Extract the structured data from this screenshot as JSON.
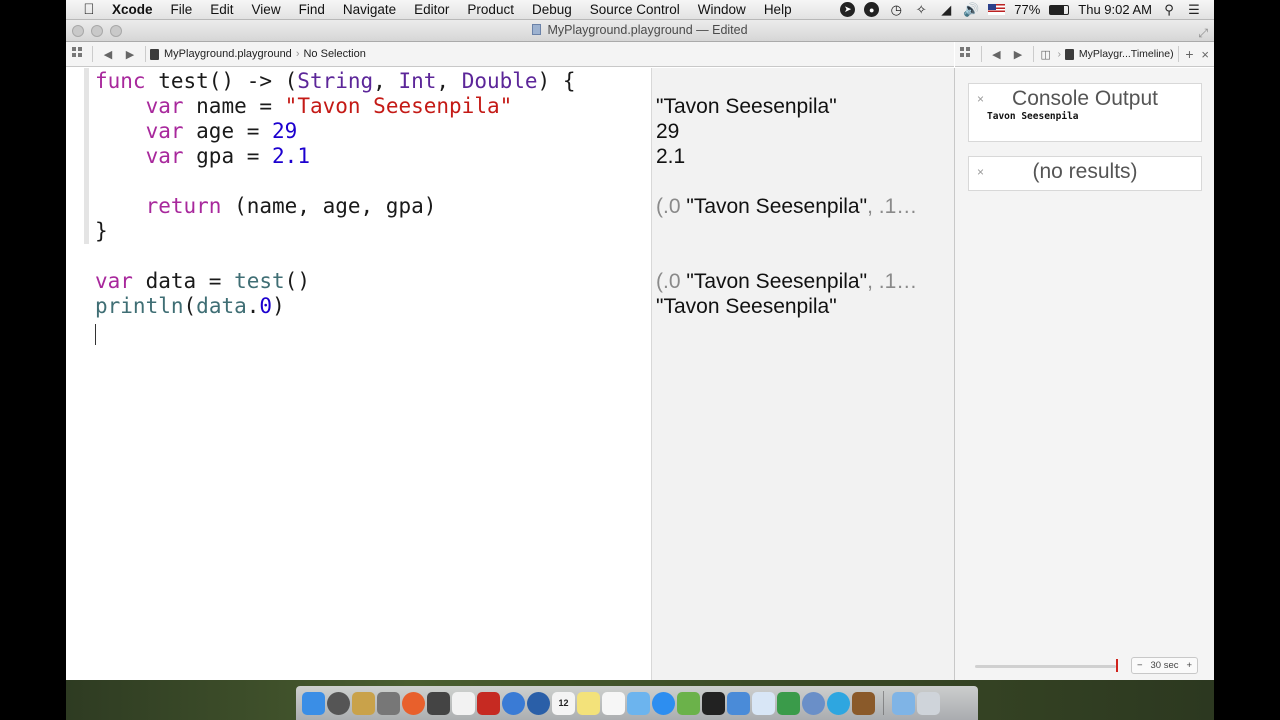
{
  "menubar": {
    "app": "Xcode",
    "items": [
      "File",
      "Edit",
      "View",
      "Find",
      "Navigate",
      "Editor",
      "Product",
      "Debug",
      "Source Control",
      "Window",
      "Help"
    ],
    "battery": "77%",
    "clock": "Thu 9:02 AM"
  },
  "window": {
    "title": "MyPlayground.playground — Edited"
  },
  "jumpbar": {
    "file": "MyPlayground.playground",
    "selection": "No Selection",
    "timeline_file": "MyPlaygr...Timeline)"
  },
  "code": {
    "lines": [
      "func test() -> (String, Int, Double) {",
      "    var name = \"Tavon Seesenpila\"",
      "    var age = 29",
      "    var gpa = 2.1",
      "",
      "    return (name, age, gpa)",
      "}",
      "",
      "var data = test()",
      "println(data.0)"
    ]
  },
  "results": {
    "r1": "\"Tavon Seesenpila\"",
    "r2": "29",
    "r3": "2.1",
    "r5a": "(.0",
    "r5b": "\"Tavon Seesenpila\"",
    "r5c": ", .1…",
    "r8a": "(.0",
    "r8b": "\"Tavon Seesenpila\"",
    "r8c": ", .1…",
    "r9": "\"Tavon Seesenpila\""
  },
  "timeline": {
    "console_title": "Console Output",
    "console_output": "Tavon Seesenpila",
    "no_results": "(no results)",
    "close_glyph": "×",
    "duration": "30 sec",
    "duration_minus": "−",
    "duration_plus": "+"
  },
  "dock": {
    "icons": [
      "finder-icon",
      "launchpad-icon",
      "database-icon",
      "photo-icon",
      "firefox-icon",
      "preview-icon",
      "textedit-icon",
      "filezilla-icon",
      "safari-icon",
      "quicktime-icon",
      "calendar-icon",
      "notes-icon",
      "reminders-icon",
      "itunes-icon",
      "appstore-icon",
      "xcode-icon",
      "terminal-icon",
      "keynote-icon",
      "pages-icon",
      "numbers-icon",
      "network-icon",
      "telegram-icon",
      "chess-icon",
      "folder-icon",
      "trash-icon"
    ],
    "calendar_day": "12"
  },
  "colors": {
    "keyword": "#a8289c",
    "string": "#c41a16",
    "number": "#1c00cf",
    "type": "#5c2699",
    "slider_thumb": "#d0231c"
  }
}
